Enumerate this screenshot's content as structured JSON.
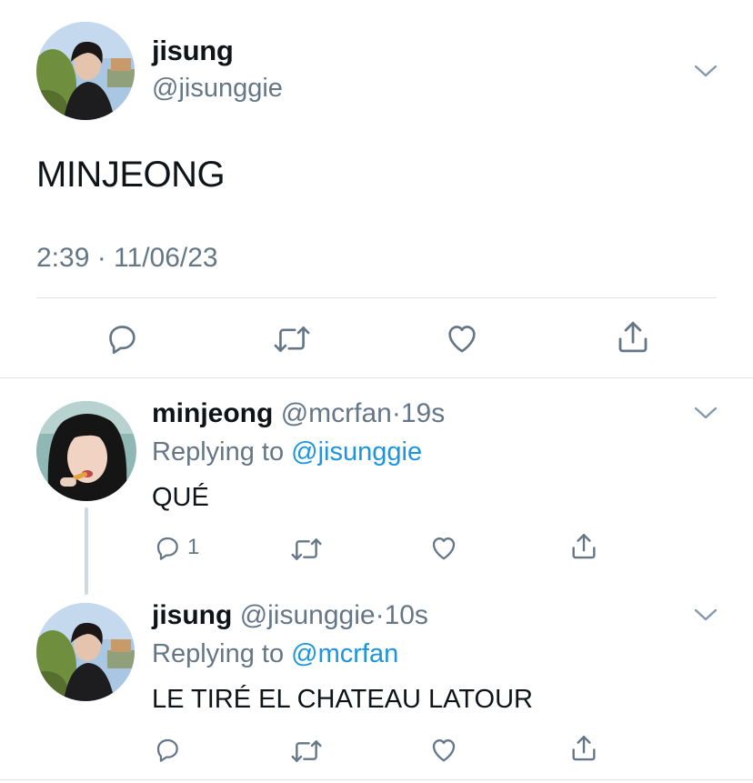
{
  "main_tweet": {
    "display_name": "jisung",
    "handle": "@jisunggie",
    "text": "MINJEONG",
    "timestamp": "2:39 · 11/06/23",
    "actions": [
      "reply-icon",
      "retweet-icon",
      "like-icon",
      "share-icon"
    ]
  },
  "replies": [
    {
      "display_name": "minjeong",
      "handle": "@mcrfan",
      "separator": "·",
      "time": "19s",
      "replying_prefix": "Replying to ",
      "replying_to": "@jisunggie",
      "text": "QUÉ",
      "reply_count": "1"
    },
    {
      "display_name": "jisung",
      "handle": "@jisunggie",
      "separator": "·",
      "time": "10s",
      "replying_prefix": "Replying to ",
      "replying_to": "@mcrfan",
      "text": "LE TIRÉ EL CHATEAU LATOUR",
      "reply_count": ""
    }
  ],
  "colors": {
    "text": "#0f1419",
    "secondary": "#657786",
    "link": "#1b95e0",
    "divider": "#dde3e8"
  }
}
